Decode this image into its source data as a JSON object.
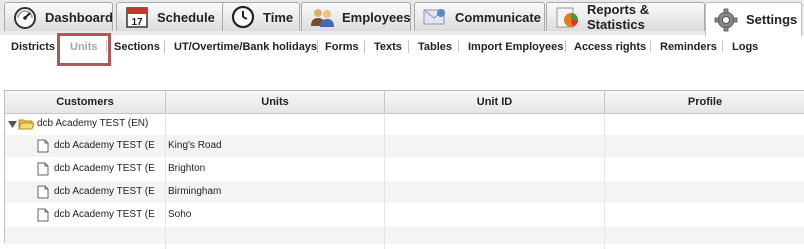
{
  "tabs": [
    {
      "label": "Dashboard",
      "icon": "gauge-icon"
    },
    {
      "label": "Schedule",
      "icon": "calendar-icon",
      "icon_text": "17"
    },
    {
      "label": "Time",
      "icon": "clock-icon"
    },
    {
      "label": "Employees",
      "icon": "people-icon"
    },
    {
      "label": "Communicate",
      "icon": "envelope-icon"
    },
    {
      "label": "Reports & Statistics",
      "icon": "pie-chart-icon"
    },
    {
      "label": "Settings",
      "icon": "gear-icon"
    }
  ],
  "active_tab": "Settings",
  "subnav": [
    {
      "label": "Districts"
    },
    {
      "label": "Units",
      "state": "selected"
    },
    {
      "label": "Sections"
    },
    {
      "label": "UT/Overtime/Bank holidays"
    },
    {
      "label": "Forms"
    },
    {
      "label": "Texts"
    },
    {
      "label": "Tables"
    },
    {
      "label": "Import Employees"
    },
    {
      "label": "Access rights"
    },
    {
      "label": "Reminders"
    },
    {
      "label": "Logs"
    }
  ],
  "grid": {
    "columns": [
      "Customers",
      "Units",
      "Unit ID",
      "Profile"
    ],
    "group": {
      "label": "dcb Academy TEST (EN)",
      "expanded": true
    },
    "rows": [
      {
        "customer": "dcb Academy TEST (E",
        "unit": "King's Road",
        "unit_id": "",
        "profile": ""
      },
      {
        "customer": "dcb Academy TEST (E",
        "unit": "Brighton",
        "unit_id": "",
        "profile": ""
      },
      {
        "customer": "dcb Academy TEST (E",
        "unit": "Birmingham",
        "unit_id": "",
        "profile": ""
      },
      {
        "customer": "dcb Academy TEST (E",
        "unit": "Soho",
        "unit_id": "",
        "profile": ""
      }
    ]
  },
  "colors": {
    "highlight": "#b05858",
    "disabled_text": "#a5a5a5",
    "folder": "#f0c24b"
  }
}
